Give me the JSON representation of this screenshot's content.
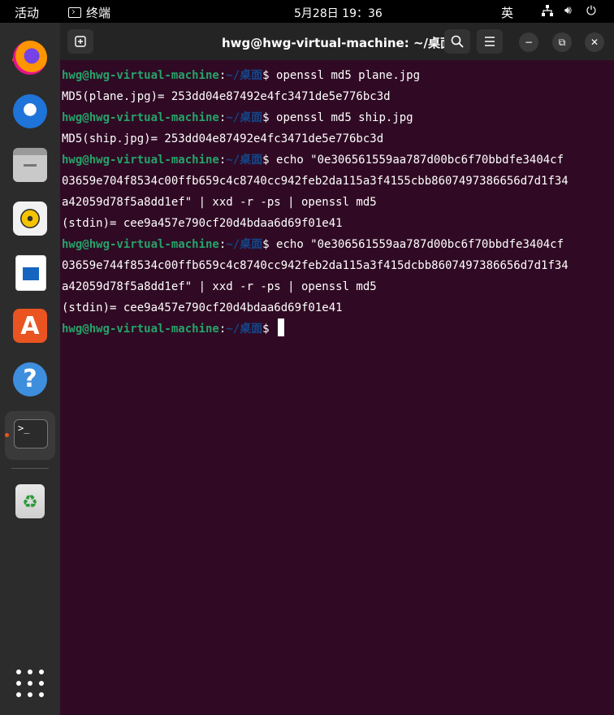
{
  "topbar": {
    "activities": "活动",
    "app_name": "终端",
    "clock": "5月28日 19：36",
    "input_method": "英",
    "icons": [
      "network-icon",
      "volume-icon",
      "power-icon"
    ]
  },
  "dock": {
    "items": [
      {
        "name": "firefox",
        "running": true
      },
      {
        "name": "thunderbird",
        "running": false
      },
      {
        "name": "files",
        "running": false
      },
      {
        "name": "rhythmbox",
        "running": false
      },
      {
        "name": "libreoffice-writer",
        "running": false
      },
      {
        "name": "ubuntu-software",
        "running": false
      },
      {
        "name": "help",
        "running": false
      },
      {
        "name": "terminal",
        "running": true,
        "active": true
      },
      {
        "name": "trash",
        "running": false
      }
    ],
    "terminal_glyph": ">_",
    "store_glyph": "A",
    "help_glyph": "?",
    "trash_glyph": "♻"
  },
  "window": {
    "title": "hwg@hwg-virtual-machine: ~/桌面"
  },
  "terminal": {
    "prompt_user": "hwg@hwg-virtual-machine",
    "prompt_sep": ":",
    "prompt_path": "~/桌面",
    "prompt_end": "$ ",
    "lines": [
      {
        "cmd": "openssl md5 plane.jpg"
      },
      {
        "out": "MD5(plane.jpg)= 253dd04e87492e4fc3471de5e776bc3d"
      },
      {
        "cmd": "openssl md5 ship.jpg"
      },
      {
        "out": "MD5(ship.jpg)= 253dd04e87492e4fc3471de5e776bc3d"
      },
      {
        "cmd": "echo \"0e306561559aa787d00bc6f70bbdfe3404cf"
      },
      {
        "out": "03659e704f8534c00ffb659c4c8740cc942feb2da115a3f4155cbb8607497386656d7d1f34"
      },
      {
        "out": "a42059d78f5a8dd1ef\" | xxd -r -ps | openssl md5"
      },
      {
        "out": "(stdin)= cee9a457e790cf20d4bdaa6d69f01e41"
      },
      {
        "cmd": "echo \"0e306561559aa787d00bc6f70bbdfe3404cf"
      },
      {
        "out": "03659e744f8534c00ffb659c4c8740cc942feb2da115a3f415dcbb8607497386656d7d1f34"
      },
      {
        "out": "a42059d78f5a8dd1ef\" | xxd -r -ps | openssl md5"
      },
      {
        "out": "(stdin)= cee9a457e790cf20d4bdaa6d69f01e41"
      },
      {
        "cmd": ""
      }
    ]
  },
  "colors": {
    "terminal_bg": "#300a24",
    "prompt_user": "#26a269",
    "prompt_path": "#12488b",
    "accent": "#e95420"
  }
}
